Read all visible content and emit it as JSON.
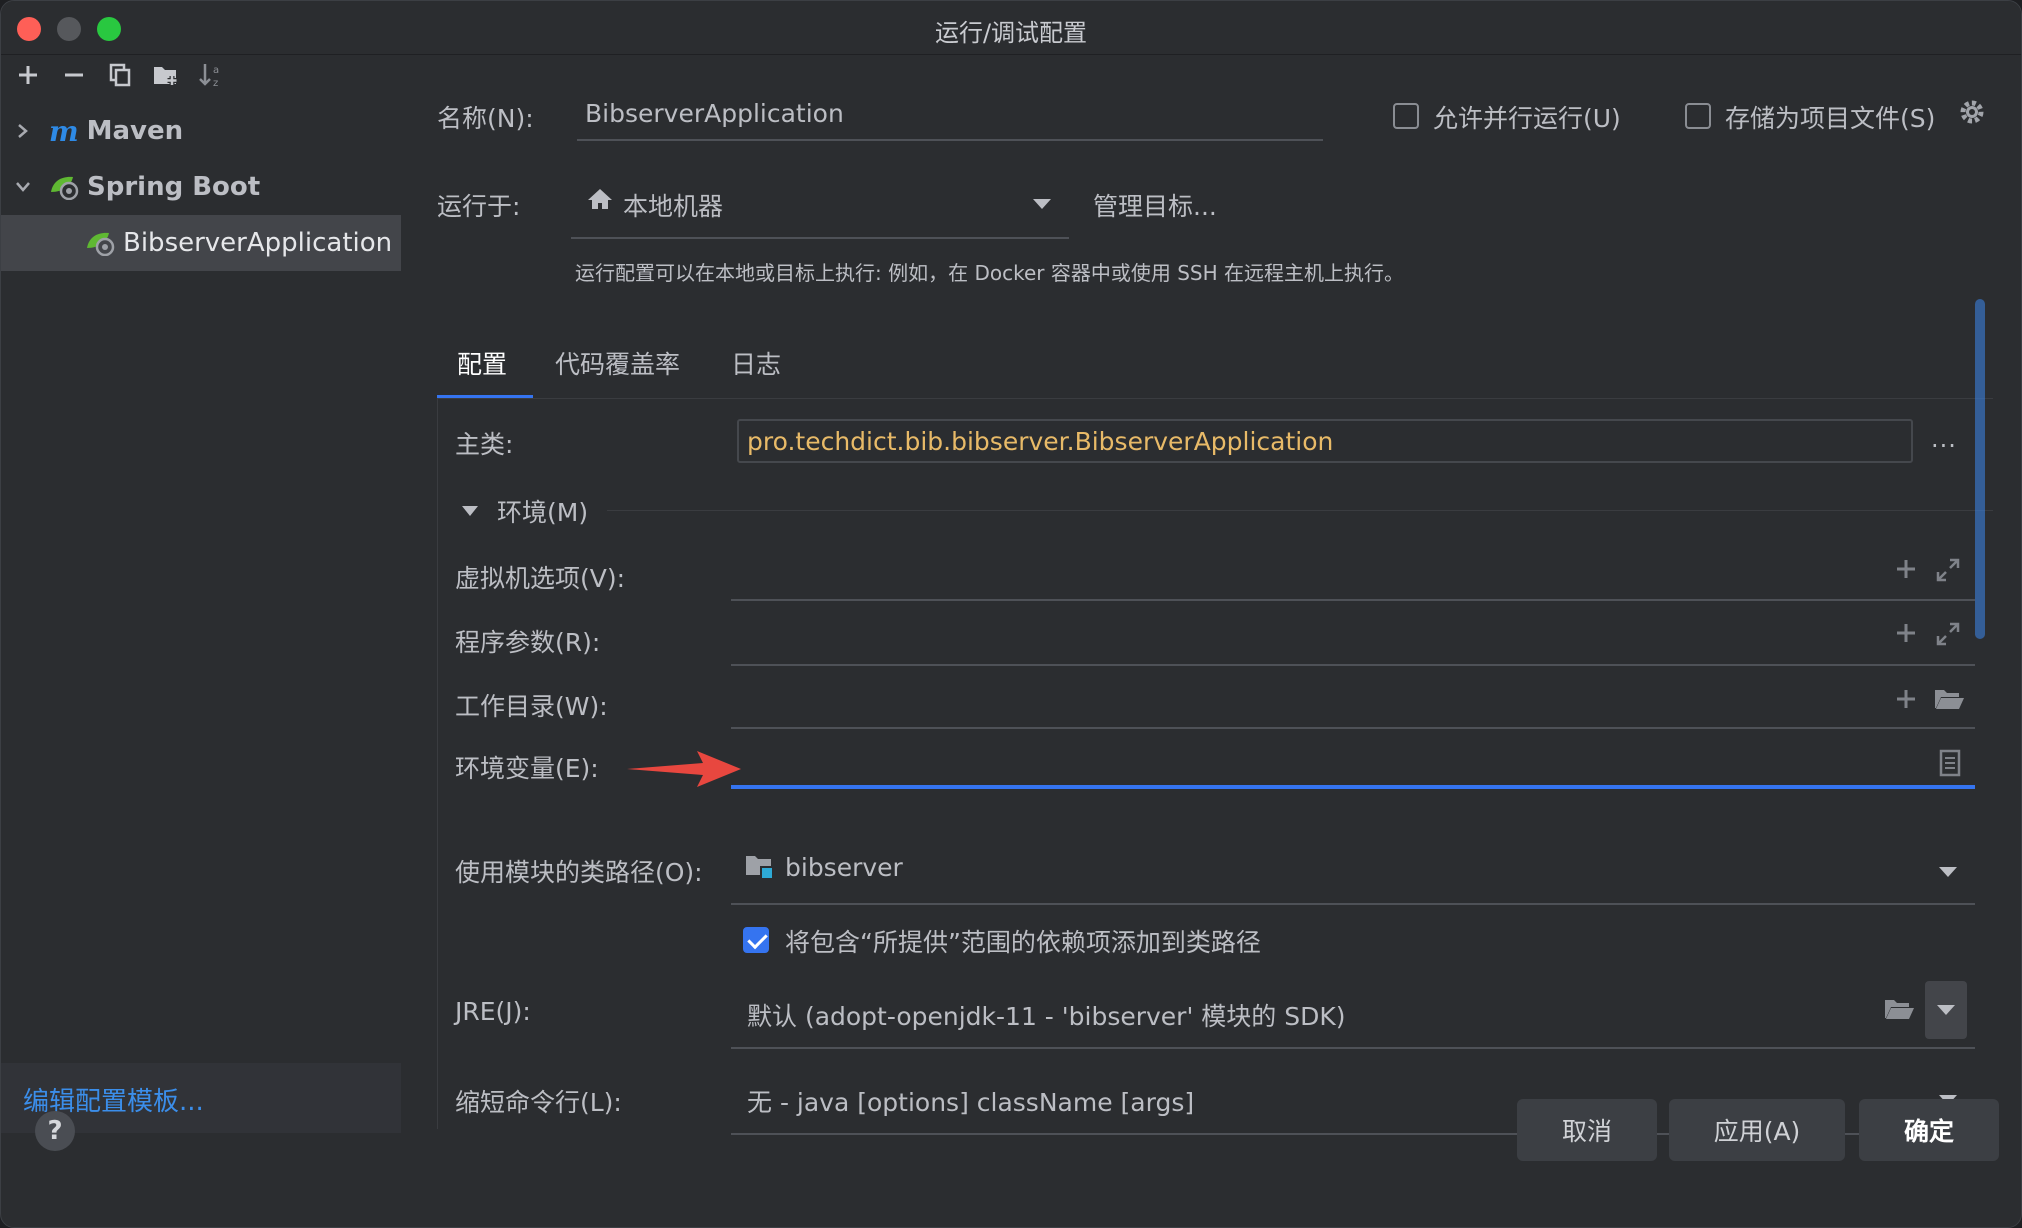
{
  "window": {
    "title": "运行/调试配置"
  },
  "sidebar": {
    "tree": [
      {
        "label": "Maven",
        "expanded": false
      },
      {
        "label": "Spring Boot",
        "expanded": true
      },
      {
        "label": "BibserverApplication",
        "selected": true
      }
    ],
    "edit_templates_link": "编辑配置模板..."
  },
  "header": {
    "name_label": "名称(N):",
    "name_value": "BibserverApplication",
    "allow_parallel_label": "允许并行运行(U)",
    "store_as_file_label": "存储为项目文件(S)",
    "run_on_label": "运行于:",
    "run_on_value": "本地机器",
    "manage_targets_link": "管理目标...",
    "run_on_hint": "运行配置可以在本地或目标上执行: 例如，在 Docker 容器中或使用 SSH 在远程主机上执行。"
  },
  "tabs": [
    "配置",
    "代码覆盖率",
    "日志"
  ],
  "config": {
    "main_class_label": "主类:",
    "main_class_value": "pro.techdict.bib.bibserver.BibserverApplication",
    "env_section_label": "环境(M)",
    "vm_options_label": "虚拟机选项(V):",
    "program_args_label": "程序参数(R):",
    "working_dir_label": "工作目录(W):",
    "env_vars_label": "环境变量(E):",
    "module_classpath_label": "使用模块的类路径(O):",
    "module_classpath_value": "bibserver",
    "include_provided_label": "将包含“所提供”范围的依赖项添加到类路径",
    "include_provided_checked": true,
    "jre_label": "JRE(J):",
    "jre_value": "默认 (adopt-openjdk-11 - 'bibserver' 模块的 SDK)",
    "shorten_label": "缩短命令行(L):",
    "shorten_value": "无 - java [options] className [args]"
  },
  "footer": {
    "cancel": "取消",
    "apply": "应用(A)",
    "ok": "确定",
    "help": "?"
  },
  "colors": {
    "accent": "#3574f0",
    "link": "#3b8eea",
    "main_class_text": "#e8ba68",
    "annotation_arrow": "#e8473f"
  }
}
